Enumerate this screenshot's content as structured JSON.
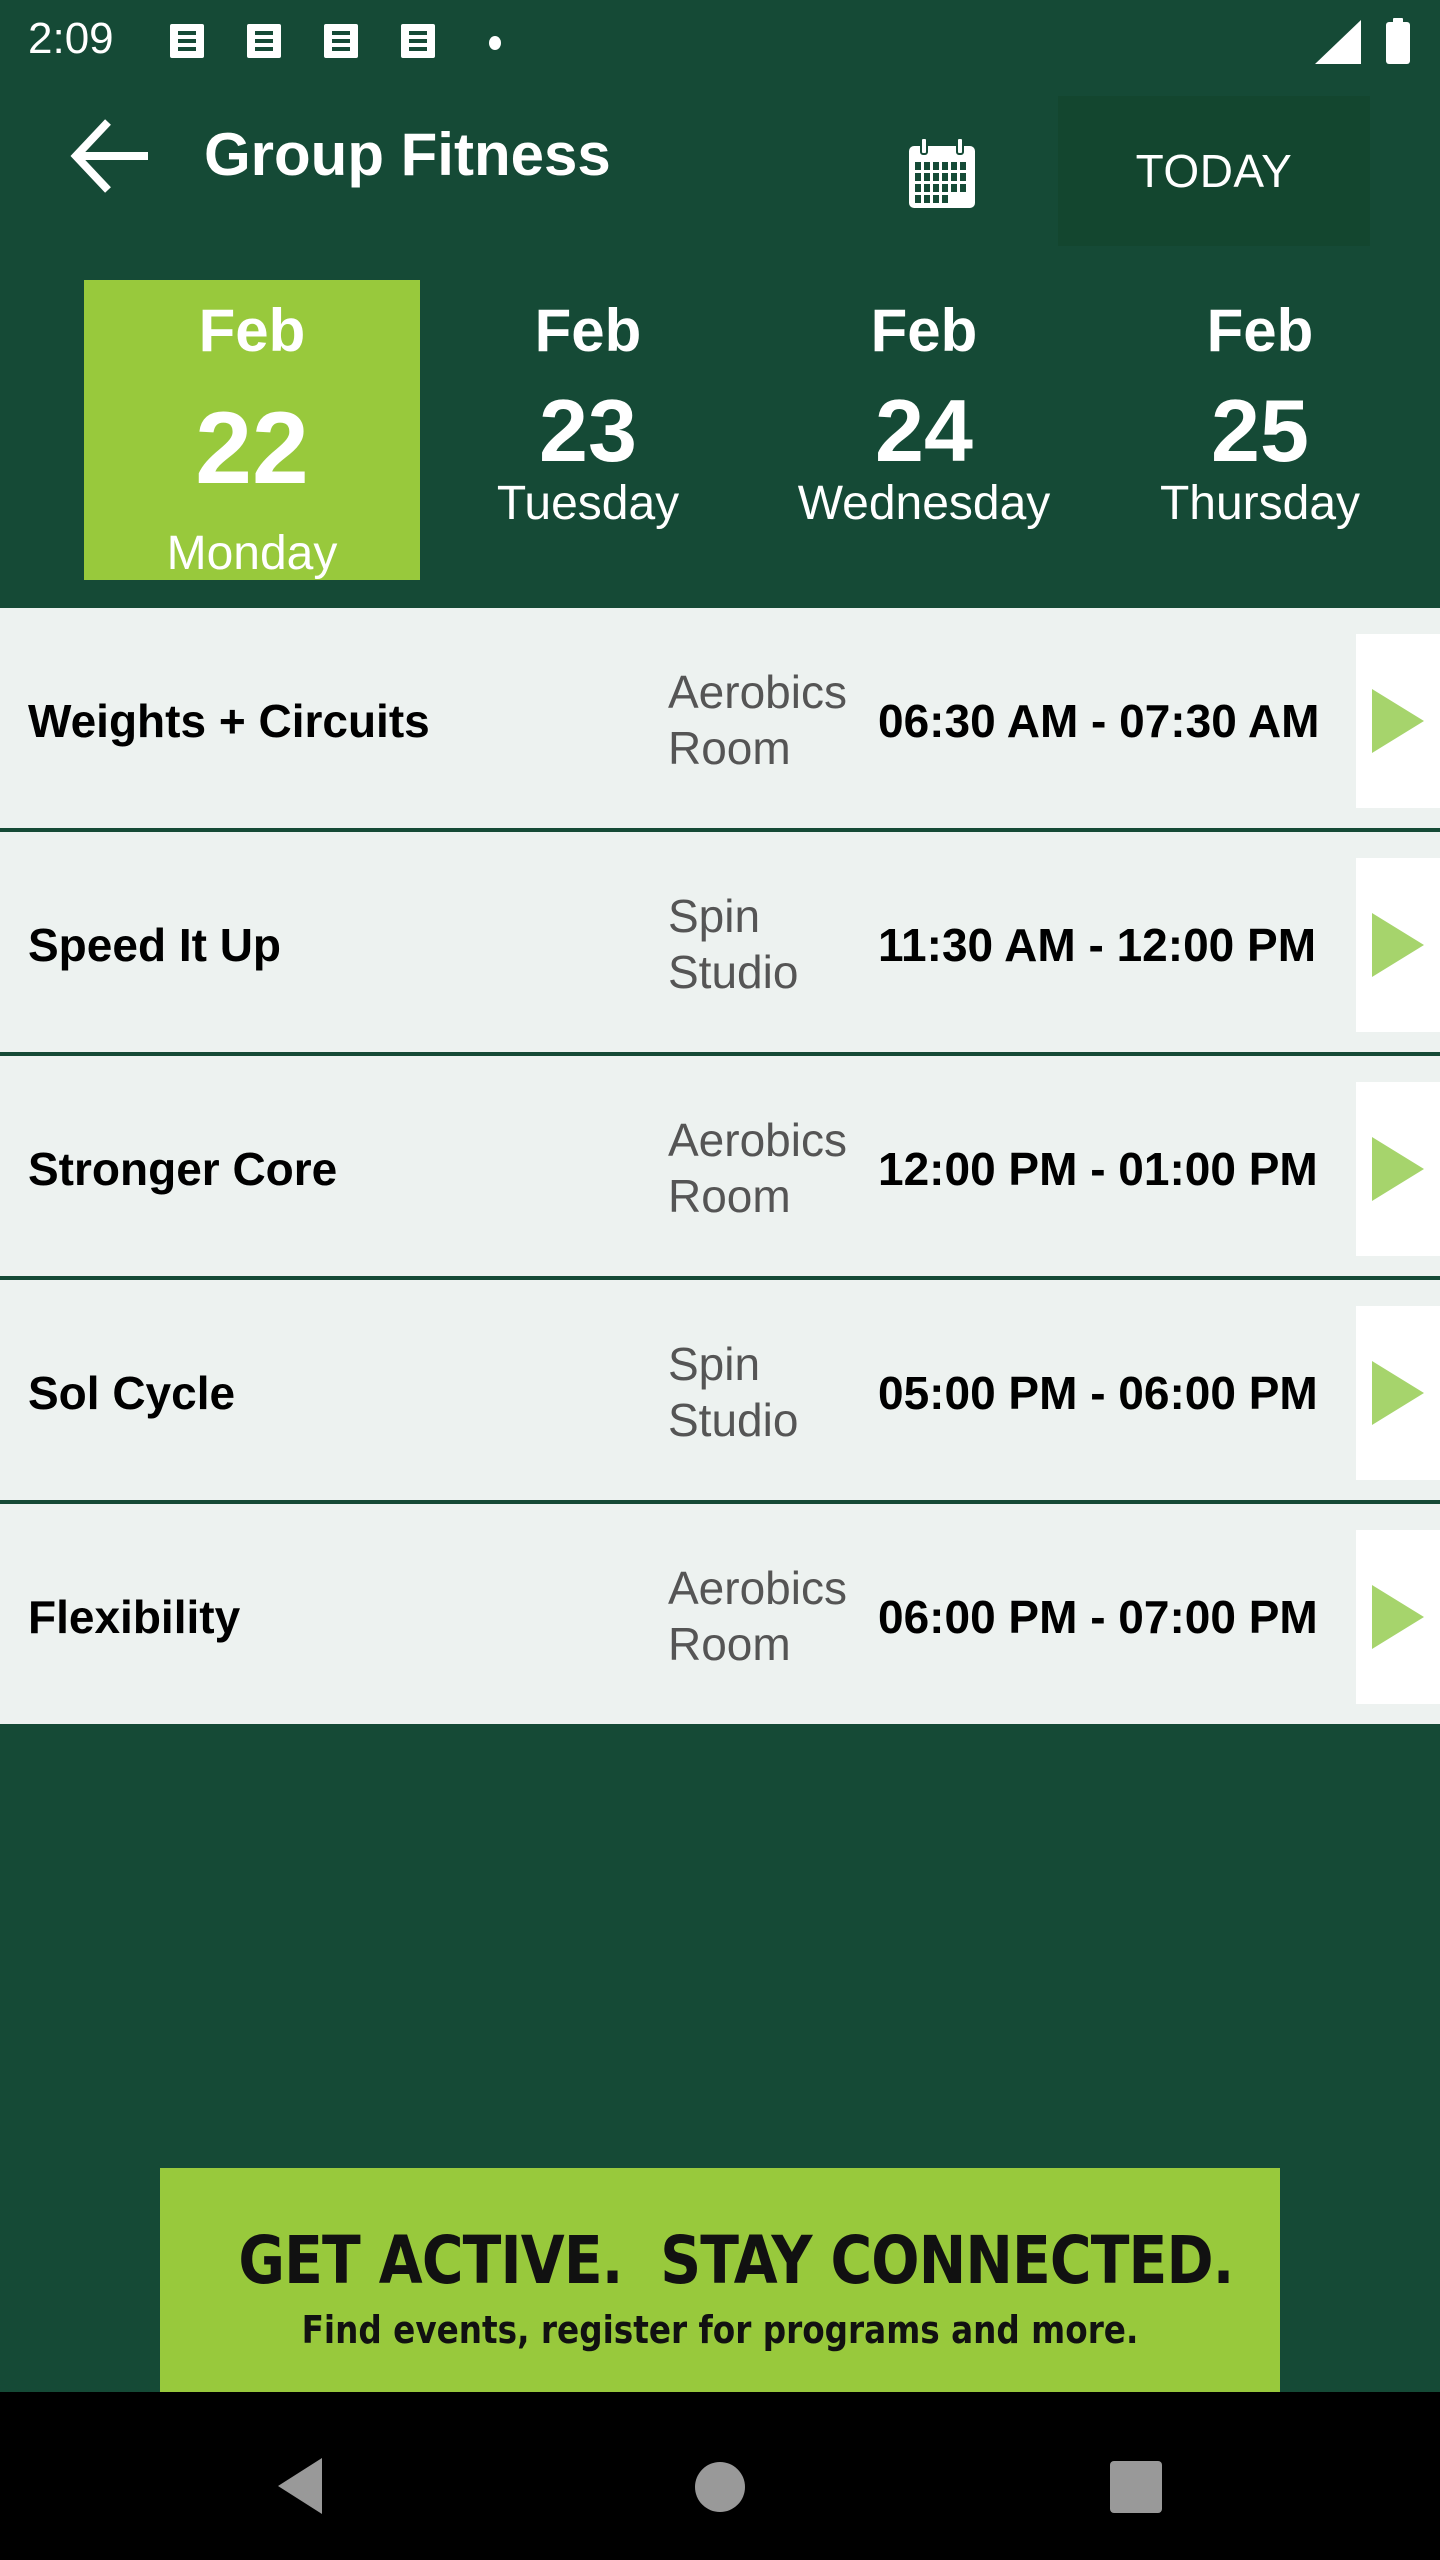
{
  "status_bar": {
    "time": "2:09",
    "notification_icons": [
      "app-notification-icon",
      "app-notification-icon",
      "app-notification-icon",
      "app-notification-icon"
    ],
    "signal_icon": "cell-signal-icon",
    "battery_icon": "battery-full-icon"
  },
  "app_bar": {
    "title": "Group Fitness",
    "back_icon": "arrow-left-icon",
    "calendar_icon": "calendar-icon",
    "today_label": "TODAY"
  },
  "dates": [
    {
      "month": "Feb",
      "day": "22",
      "weekday": "Monday",
      "selected": true
    },
    {
      "month": "Feb",
      "day": "23",
      "weekday": "Tuesday",
      "selected": false
    },
    {
      "month": "Feb",
      "day": "24",
      "weekday": "Wednesday",
      "selected": false
    },
    {
      "month": "Feb",
      "day": "25",
      "weekday": "Thursday",
      "selected": false
    }
  ],
  "classes": [
    {
      "name": "Weights + Circuits",
      "location": "Aerobics Room",
      "time": "06:30 AM - 07:30 AM"
    },
    {
      "name": "Speed It Up",
      "location": "Spin Studio",
      "time": "11:30 AM - 12:00 PM"
    },
    {
      "name": "Stronger Core",
      "location": "Aerobics Room",
      "time": "12:00 PM - 01:00 PM"
    },
    {
      "name": "Sol Cycle",
      "location": "Spin Studio",
      "time": "05:00 PM - 06:00 PM"
    },
    {
      "name": "Flexibility",
      "location": "Aerobics Room",
      "time": "06:00 PM - 07:00 PM"
    }
  ],
  "banner": {
    "headline": "GET ACTIVE.  STAY CONNECTED.",
    "subtext": "Find events, register for programs and more."
  },
  "colors": {
    "primary_dark_green": "#154a36",
    "accent_lime": "#98c93c",
    "arrow_green": "#a6d46c",
    "row_background": "#edf2f0"
  },
  "nav_bar": {
    "back_icon": "nav-back-icon",
    "home_icon": "nav-home-icon",
    "recents_icon": "nav-recents-icon"
  }
}
